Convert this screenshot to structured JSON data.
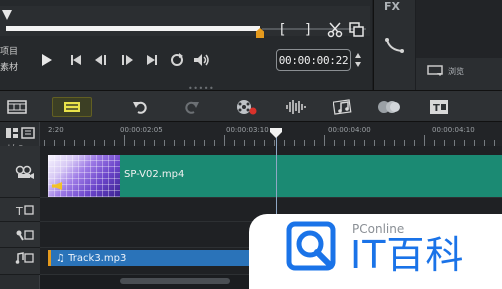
{
  "player": {
    "side_labels": [
      "项目",
      "素材"
    ],
    "timecode": "00:00:00:22",
    "in_mark": "[",
    "out_mark": "]"
  },
  "right_panel": {
    "fx_label": "FX",
    "library_label": "浏览"
  },
  "ruler": {
    "labels": [
      "2:20",
      "00:00:02:05",
      "00:00:03:10",
      "00:00:04:00",
      "00:00:04:10"
    ]
  },
  "tracks": {
    "video_clip": "SP-V02.mp4",
    "audio_clip": "Track3.mp3"
  },
  "watermark": {
    "site": "PConline",
    "brand": "IT百科"
  },
  "colors": {
    "video_clip": "#1b8a73",
    "audio_clip": "#2a73b9",
    "accent": "#e59a1d",
    "brand": "#1a73e8"
  }
}
